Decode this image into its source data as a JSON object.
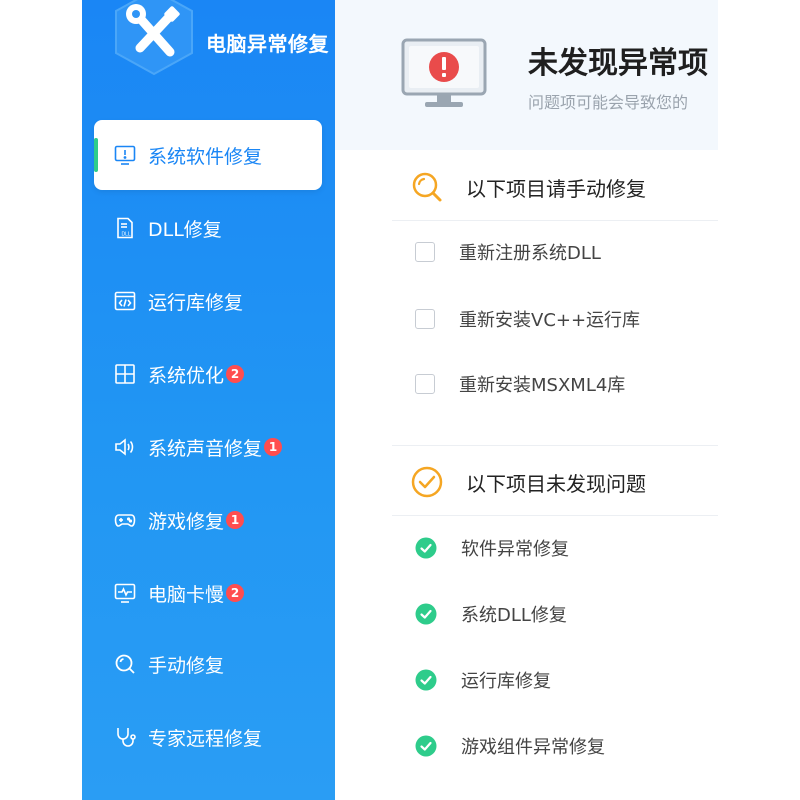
{
  "colors": {
    "sidebar_blue": "#1a86f5",
    "accent_green": "#2ecc8b",
    "warning_orange": "#f5a623",
    "alert_red": "#e94b4b",
    "badge_red": "#ff4d4f"
  },
  "app": {
    "logo_text": "电脑异常修复",
    "logo_icon": "wrench-screwdriver-icon"
  },
  "sidebar": {
    "items": [
      {
        "label": "系统软件修复",
        "icon": "monitor-alert-icon",
        "badge": ""
      },
      {
        "label": "DLL修复",
        "icon": "dll-file-icon",
        "badge": ""
      },
      {
        "label": "运行库修复",
        "icon": "code-window-icon",
        "badge": ""
      },
      {
        "label": "系统优化",
        "icon": "windows-icon",
        "badge": "2"
      },
      {
        "label": "系统声音修复",
        "icon": "speaker-icon",
        "badge": "1"
      },
      {
        "label": "游戏修复",
        "icon": "gamepad-icon",
        "badge": "1"
      },
      {
        "label": "电脑卡慢",
        "icon": "monitor-pulse-icon",
        "badge": "2"
      },
      {
        "label": "手动修复",
        "icon": "search-icon",
        "badge": ""
      },
      {
        "label": "专家远程修复",
        "icon": "stethoscope-icon",
        "badge": ""
      }
    ]
  },
  "header": {
    "title": "未发现异常项",
    "subtitle": "问题项可能会导致您的",
    "icon": "monitor-alert-icon"
  },
  "manual_section": {
    "title": "以下项目请手动修复",
    "icon": "search-icon",
    "items": [
      {
        "label": "重新注册系统DLL",
        "checked": false
      },
      {
        "label": "重新安装VC++运行库",
        "checked": false
      },
      {
        "label": "重新安装MSXML4库",
        "checked": false
      }
    ]
  },
  "ok_section": {
    "title": "以下项目未发现问题",
    "icon": "check-circle-icon",
    "items": [
      {
        "label": "软件异常修复"
      },
      {
        "label": "系统DLL修复"
      },
      {
        "label": "运行库修复"
      },
      {
        "label": "游戏组件异常修复"
      }
    ]
  }
}
